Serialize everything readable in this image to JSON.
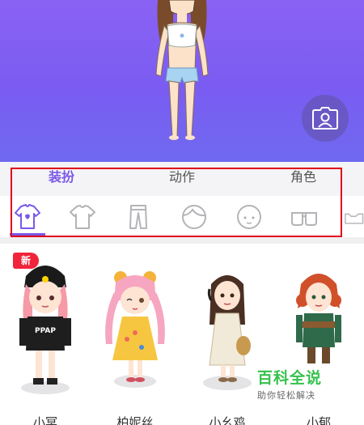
{
  "tabs": [
    {
      "label": "装扮",
      "active": true
    },
    {
      "label": "动作",
      "active": false
    },
    {
      "label": "角色",
      "active": false
    }
  ],
  "categories": [
    "top-clothing-icon",
    "tshirt-icon",
    "pants-icon",
    "hair-icon",
    "face-icon",
    "glasses-icon",
    "accessory-icon"
  ],
  "characters": [
    {
      "name": "小冥",
      "badge": "新"
    },
    {
      "name": "柏妮丝"
    },
    {
      "name": "小幺鸡"
    },
    {
      "name": "小郁"
    }
  ],
  "watermark": {
    "title": "百科全说",
    "subtitle": "助你轻松解决"
  },
  "colors": {
    "accent": "#7b58e8",
    "stage": "#7a5cf2",
    "highlight": "#e0001b",
    "badge": "#f0243b",
    "watermark": "#36c24d"
  }
}
